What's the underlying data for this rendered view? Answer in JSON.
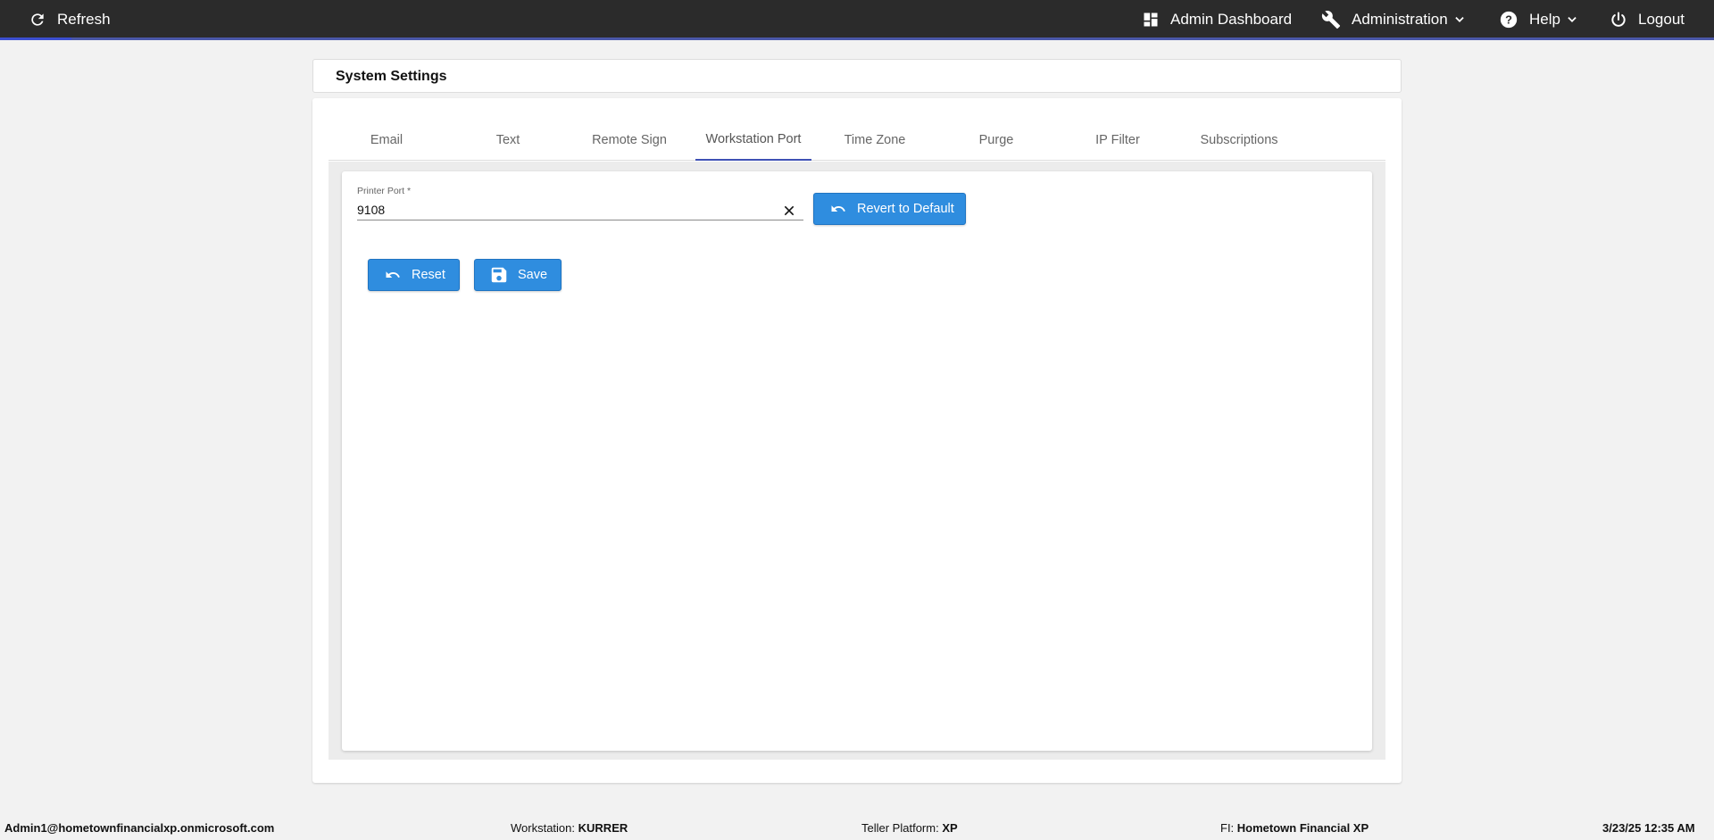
{
  "topbar": {
    "refresh_label": "Refresh",
    "admin_dashboard_label": "Admin Dashboard",
    "administration_label": "Administration",
    "help_label": "Help",
    "logout_label": "Logout",
    "bg_color": "#2b2b2b",
    "progress_color": "#3c4fd0"
  },
  "page": {
    "title": "System Settings"
  },
  "tabs": [
    {
      "label": "Email"
    },
    {
      "label": "Text"
    },
    {
      "label": "Remote Sign"
    },
    {
      "label": "Workstation Port",
      "active": true
    },
    {
      "label": "Time Zone"
    },
    {
      "label": "Purge"
    },
    {
      "label": "IP Filter"
    },
    {
      "label": "Subscriptions"
    }
  ],
  "form": {
    "printer_port_label": "Printer Port *",
    "printer_port_value": "9108",
    "revert_label": "Revert to Default",
    "reset_label": "Reset",
    "save_label": "Save"
  },
  "footer": {
    "user": "Admin1@hometownfinancialxp.onmicrosoft.com",
    "workstation_label": "Workstation:",
    "workstation_value": "KURRER",
    "platform_label": "Teller Platform:",
    "platform_value": "XP",
    "fi_label": "FI:",
    "fi_value": "Hometown Financial XP",
    "datetime": "3/23/25 12:35 AM"
  },
  "colors": {
    "accent": "#3f51b5",
    "button": "#2f8ddf"
  },
  "icons": [
    "refresh-icon",
    "dashboard-icon",
    "wrench-icon",
    "help-icon",
    "power-icon",
    "chevron-down-icon",
    "close-icon",
    "undo-icon",
    "save-icon"
  ]
}
